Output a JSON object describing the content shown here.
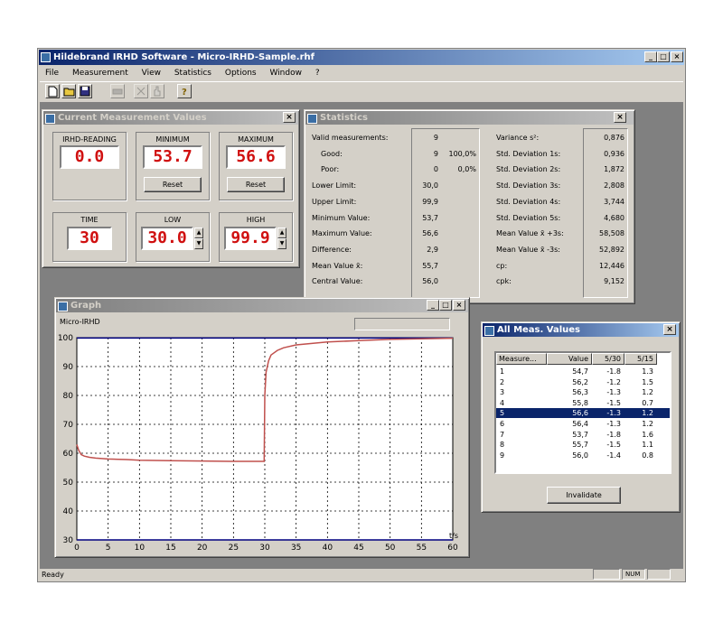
{
  "window": {
    "title": "Hildebrand IRHD Software - Micro-IRHD-Sample.rhf",
    "min": "_",
    "max": "□",
    "close": "×"
  },
  "menu": [
    "File",
    "Measurement",
    "View",
    "Statistics",
    "Options",
    "Window",
    "?"
  ],
  "toolbar_icons": [
    "new-file-icon",
    "open-folder-icon",
    "save-icon",
    "print-icon",
    "measure-icon",
    "hand-icon",
    "help-icon"
  ],
  "current": {
    "title": "Current Measurement Values",
    "irhd_label": "IRHD-READING",
    "irhd_value": "0.0",
    "min_label": "MINIMUM",
    "min_value": "53.7",
    "max_label": "MAXIMUM",
    "max_value": "56.6",
    "reset": "Reset",
    "time_label": "TIME",
    "time_value": "30",
    "low_label": "LOW",
    "low_value": "30.0",
    "high_label": "HIGH",
    "high_value": "99.9"
  },
  "statistics": {
    "title": "Statistics",
    "left": [
      {
        "label": "Valid measurements:",
        "value": "9",
        "extra": ""
      },
      {
        "label": "Good:",
        "value": "9",
        "extra": "100,0%"
      },
      {
        "label": "Poor:",
        "value": "0",
        "extra": "0,0%"
      },
      {
        "label": "Lower Limit:",
        "value": "30,0",
        "extra": ""
      },
      {
        "label": "Upper Limit:",
        "value": "99,9",
        "extra": ""
      },
      {
        "label": "Minimum Value:",
        "value": "53,7",
        "extra": ""
      },
      {
        "label": "Maximum Value:",
        "value": "56,6",
        "extra": ""
      },
      {
        "label": "Difference:",
        "value": "2,9",
        "extra": ""
      },
      {
        "label": "Mean Value x̄:",
        "value": "55,7",
        "extra": ""
      },
      {
        "label": "Central Value:",
        "value": "56,0",
        "extra": ""
      }
    ],
    "right": [
      {
        "label": "Variance s²:",
        "value": "0,876"
      },
      {
        "label": "Std. Deviation 1s:",
        "value": "0,936"
      },
      {
        "label": "Std. Deviation 2s:",
        "value": "1,872"
      },
      {
        "label": "Std. Deviation 3s:",
        "value": "2,808"
      },
      {
        "label": "Std. Deviation 4s:",
        "value": "3,744"
      },
      {
        "label": "Std. Deviation 5s:",
        "value": "4,680"
      },
      {
        "label": "Mean Value x̄ +3s:",
        "value": "58,508"
      },
      {
        "label": "Mean Value x̄ -3s:",
        "value": "52,892"
      },
      {
        "label": "cp:",
        "value": "12,446"
      },
      {
        "label": "cpk:",
        "value": "9,152"
      }
    ]
  },
  "graph": {
    "title": "Graph",
    "series_label": "Micro-IRHD",
    "x_unit": "t/s"
  },
  "chart_data": {
    "type": "line",
    "xlabel": "t/s",
    "ylabel": "Micro-IRHD",
    "xlim": [
      0,
      60
    ],
    "ylim": [
      30,
      100
    ],
    "x_ticks": [
      0,
      5,
      10,
      15,
      20,
      25,
      30,
      35,
      40,
      45,
      50,
      55,
      60
    ],
    "y_ticks": [
      30,
      40,
      50,
      60,
      70,
      80,
      90,
      100
    ],
    "grid": true,
    "series": [
      {
        "x": [
          0,
          0.3,
          0.7,
          1.2,
          2,
          3,
          5,
          8,
          10,
          15,
          20,
          25,
          29.9,
          30.0,
          30.2,
          30.6,
          31,
          32,
          33,
          35,
          40,
          45,
          50,
          55,
          60
        ],
        "y": [
          63,
          61,
          59.5,
          59,
          58.6,
          58.3,
          58,
          57.8,
          57.6,
          57.4,
          57.3,
          57.2,
          57.2,
          80,
          88,
          92,
          94,
          95.6,
          96.5,
          97.5,
          98.5,
          99,
          99.4,
          99.6,
          99.8
        ],
        "color": "#c0504d"
      }
    ],
    "limit_lines": [
      {
        "y": 99.9,
        "color": "#000080"
      },
      {
        "y": 30.0,
        "color": "#000080"
      }
    ]
  },
  "all_values": {
    "title": "All Meas. Values",
    "headers": [
      "Measure...",
      "Value",
      "5/30",
      "5/15"
    ],
    "rows": [
      [
        "1",
        "54,7",
        "-1.8",
        "1.3"
      ],
      [
        "2",
        "56,2",
        "-1.2",
        "1.5"
      ],
      [
        "3",
        "56,3",
        "-1.3",
        "1.2"
      ],
      [
        "4",
        "55,8",
        "-1.5",
        "0.7"
      ],
      [
        "5",
        "56,6",
        "-1.3",
        "1.2"
      ],
      [
        "6",
        "56,4",
        "-1.3",
        "1.2"
      ],
      [
        "7",
        "53,7",
        "-1.8",
        "1.6"
      ],
      [
        "8",
        "55,7",
        "-1.5",
        "1.1"
      ],
      [
        "9",
        "56,0",
        "-1.4",
        "0.8"
      ]
    ],
    "selected_row": 4,
    "invalidate": "Invalidate"
  },
  "status": {
    "text": "Ready",
    "num": "NUM"
  }
}
